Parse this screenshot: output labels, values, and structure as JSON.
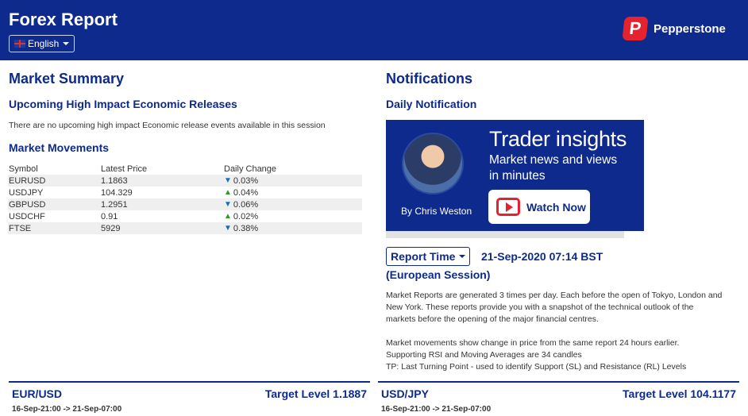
{
  "header": {
    "title": "Forex Report",
    "language": "English",
    "brand": "Pepperstone",
    "brand_initial": "P"
  },
  "market_summary": {
    "title": "Market Summary",
    "upcoming_title": "Upcoming High Impact Economic Releases",
    "upcoming_text": "There are no upcoming high impact Economic release events available in this session",
    "movements_title": "Market Movements",
    "columns": [
      "Symbol",
      "Latest Price",
      "Daily Change"
    ],
    "rows": [
      {
        "symbol": "EURUSD",
        "price": "1.1863",
        "change": "0.03%",
        "direction": "down"
      },
      {
        "symbol": "USDJPY",
        "price": "104.329",
        "change": "0.04%",
        "direction": "up"
      },
      {
        "symbol": "GBPUSD",
        "price": "1.2951",
        "change": "0.06%",
        "direction": "down"
      },
      {
        "symbol": "USDCHF",
        "price": "0.91",
        "change": "0.02%",
        "direction": "up"
      },
      {
        "symbol": "FTSE",
        "price": "5929",
        "change": "0.38%",
        "direction": "down"
      }
    ]
  },
  "notifications": {
    "title": "Notifications",
    "daily_title": "Daily Notification",
    "promo": {
      "title": "Trader insights",
      "subtitle_line1": "Market news and views",
      "subtitle_line2": "in minutes",
      "byline": "By Chris Weston",
      "button": "Watch Now"
    },
    "report_time_label": "Report Time",
    "report_time_value": "21-Sep-2020 07:14 BST",
    "session": "(European Session)",
    "para1_l1": "Market Reports are generated 3 times per day. Each before the open of Tokyo, London and",
    "para1_l2": "New York. These reports provide you with a snapshot of the technical outlook of the",
    "para1_l3": "markets before the opening of the major financial centres.",
    "para2_l1": "Market movements show change in price from the same report 24 hours earlier.",
    "para2_l2": "Supporting RSI and Moving Averages are 34 candles",
    "para2_l3": "TP: Last Turning Point - used to identify Support (SL) and Resistance (RL) Levels"
  },
  "panels": [
    {
      "pair": "EUR/USD",
      "target": "Target Level 1.1887",
      "range": "16-Sep-21:00 -> 21-Sep-07:00"
    },
    {
      "pair": "USD/JPY",
      "target": "Target Level 104.1177",
      "range": "16-Sep-21:00 -> 21-Sep-07:00"
    }
  ],
  "colors": {
    "primary": "#0d2a8c",
    "brand_red": "#e5232f",
    "up": "#2a9a2a",
    "down": "#1a6fb3"
  }
}
